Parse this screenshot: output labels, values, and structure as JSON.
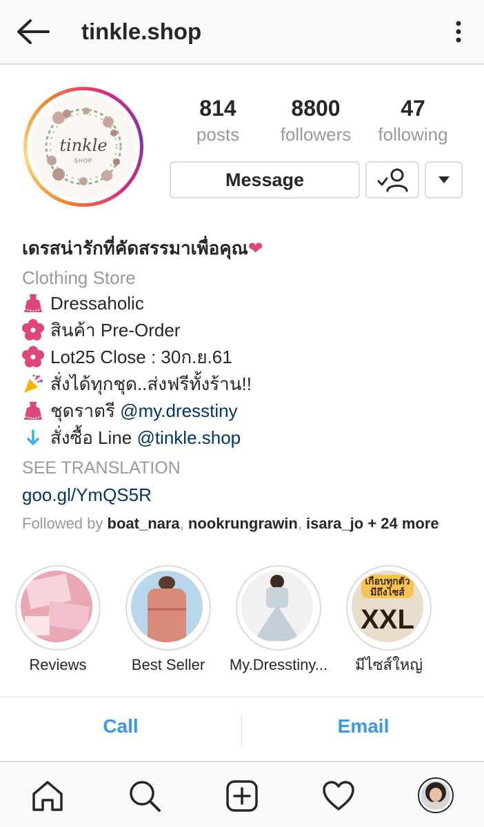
{
  "header": {
    "title": "tinkle.shop"
  },
  "profile": {
    "avatar_brand": "tinkle",
    "avatar_brand_sub": "SHOP",
    "stats": [
      {
        "value": "814",
        "label": "posts"
      },
      {
        "value": "8800",
        "label": "followers"
      },
      {
        "value": "47",
        "label": "following"
      }
    ],
    "message_button": "Message"
  },
  "bio": {
    "name": "เดรสน่ารักที่คัดสรรมาเพื่อคุณ❤",
    "category": "Clothing Store",
    "lines": [
      {
        "icon": "dress-icon",
        "text": "Dressaholic"
      },
      {
        "icon": "flower-icon",
        "text": "สินค้า Pre-Order"
      },
      {
        "icon": "flower-icon",
        "text": "Lot25 Close : 30ก.ย.61"
      },
      {
        "icon": "party-popper-icon",
        "text": "สั่งได้ทุกชุด..ส่งฟรีทั้งร้าน!!"
      },
      {
        "icon": "dress-icon",
        "text": "ชุดราตรี ",
        "mention": "@my.dresstiny"
      },
      {
        "icon": "down-arrow-icon",
        "text": "สั่งซื้อ Line ",
        "mention": "@tinkle.shop"
      }
    ],
    "see_translation": "SEE TRANSLATION",
    "link": "goo.gl/YmQS5R",
    "followed_prefix": "Followed by ",
    "followed_users": [
      "boat_nara",
      "nookrungrawin",
      "isara_jo"
    ],
    "followed_suffix": "+ 24 more"
  },
  "highlights": [
    {
      "label": "Reviews"
    },
    {
      "label": "Best Seller"
    },
    {
      "label": "My.Dresstiny..."
    },
    {
      "label": "มีไซส์ใหญ่",
      "overlay_top": "เกือบทุกตัว",
      "overlay_mid": "มีถึงไซส์",
      "overlay_big": "XXL"
    }
  ],
  "contact": {
    "call": "Call",
    "email": "Email"
  },
  "colors": {
    "link": "#003569",
    "accent": "#3897f0",
    "muted": "#999999",
    "heart": "#e0457b"
  }
}
